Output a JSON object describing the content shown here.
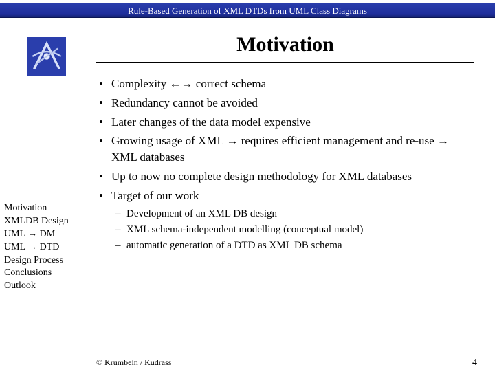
{
  "header": {
    "title": "Rule-Based Generation of XML DTDs from UML Class Diagrams"
  },
  "slide": {
    "title": "Motivation"
  },
  "bullets": [
    {
      "text": "Complexity ←→ correct schema"
    },
    {
      "text": "Redundancy cannot be avoided"
    },
    {
      "text": "Later changes of the data model expensive"
    },
    {
      "text": "Growing usage of XML → requires efficient management and re-use → XML databases"
    },
    {
      "text": "Up to now no complete design methodology for XML databases"
    },
    {
      "text": "Target of our work",
      "sub": [
        "Development of an XML DB design",
        "XML schema-independent modelling (conceptual model)",
        "automatic generation of a DTD as XML DB schema"
      ]
    }
  ],
  "sidebar": {
    "items": [
      "Motivation",
      "XMLDB Design",
      "UML → DM",
      "UML → DTD",
      "Design Process",
      "Conclusions",
      "Outlook"
    ]
  },
  "footer": {
    "copyright": "© Krumbein / Kudrass",
    "page": "4"
  }
}
